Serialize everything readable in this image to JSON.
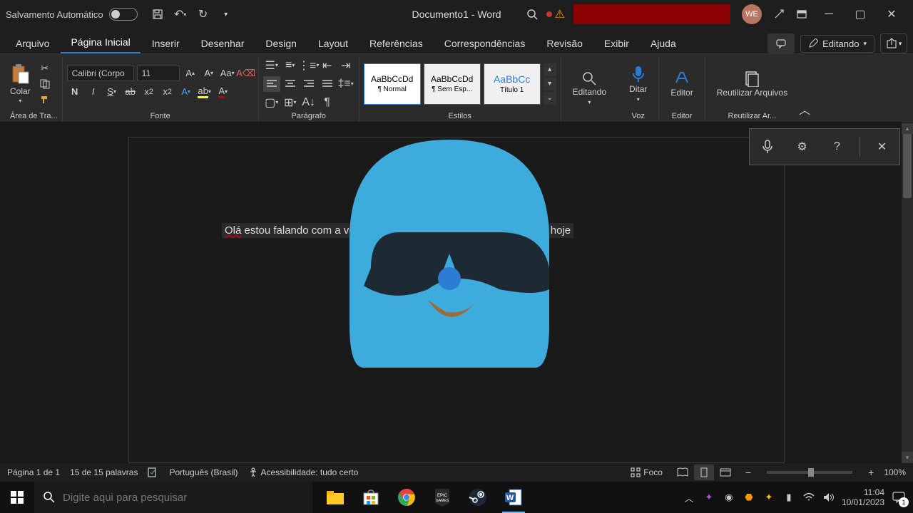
{
  "titlebar": {
    "autosave": "Salvamento Automático",
    "doc_title": "Documento1  -  Word",
    "user_initials": "WE"
  },
  "tabs": {
    "items": [
      "Arquivo",
      "Página Inicial",
      "Inserir",
      "Desenhar",
      "Design",
      "Layout",
      "Referências",
      "Correspondências",
      "Revisão",
      "Exibir",
      "Ajuda"
    ],
    "active_index": 1,
    "edit_mode": "Editando"
  },
  "ribbon": {
    "clipboard": {
      "paste": "Colar",
      "group": "Área de Tra..."
    },
    "font": {
      "name": "Calibri (Corpo",
      "size": "11",
      "group": "Fonte",
      "highlight_color": "#ffff00",
      "font_color": "#c00000"
    },
    "paragraph": {
      "group": "Parágrafo"
    },
    "styles": {
      "group": "Estilos",
      "items": [
        {
          "preview": "AaBbCcDd",
          "name": "¶ Normal",
          "blue": false
        },
        {
          "preview": "AaBbCcDd",
          "name": "¶ Sem Esp...",
          "blue": false
        },
        {
          "preview": "AaBbCc",
          "name": "Título 1",
          "blue": true
        }
      ]
    },
    "editing": {
      "label": "Editando"
    },
    "voice": {
      "label": "Ditar",
      "group": "Voz"
    },
    "editor": {
      "label": "Editor",
      "group": "Editor"
    },
    "reuse": {
      "label": "Reutilizar Arquivos",
      "group": "Reutilizar Ar..."
    }
  },
  "document": {
    "text_before": "Olá",
    "text_mid": " estou falando com a vo",
    "text_after": " hoje"
  },
  "statusbar": {
    "page": "Página 1 de 1",
    "words": "15 de 15 palavras",
    "language": "Português (Brasil)",
    "accessibility": "Acessibilidade: tudo certo",
    "focus": "Foco",
    "zoom": "100%"
  },
  "taskbar": {
    "search_placeholder": "Digite aqui para pesquisar",
    "time": "11:04",
    "date": "10/01/2023",
    "notif_count": "1"
  }
}
